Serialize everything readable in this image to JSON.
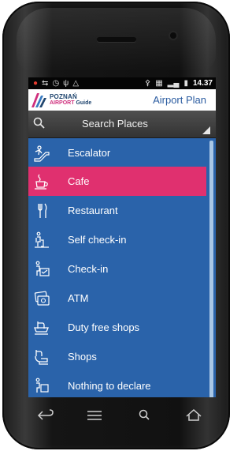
{
  "status_bar": {
    "time": "14.37",
    "icons": [
      "notification-icon",
      "link-icon",
      "alarm-icon",
      "usb-icon",
      "warning-icon",
      "wifi-icon",
      "vibrate-icon",
      "signal-icon",
      "battery-icon"
    ]
  },
  "header": {
    "logo_line1": "POZNAŃ",
    "logo_line2_a": "AIRPORT",
    "logo_line2_b": "Guide",
    "title": "Airport Plan"
  },
  "search": {
    "label": "Search Places"
  },
  "list": {
    "items": [
      {
        "label": "Escalator",
        "icon": "escalator-icon",
        "selected": false
      },
      {
        "label": "Cafe",
        "icon": "cafe-icon",
        "selected": true
      },
      {
        "label": "Restaurant",
        "icon": "restaurant-icon",
        "selected": false
      },
      {
        "label": "Self check-in",
        "icon": "self-check-in-icon",
        "selected": false
      },
      {
        "label": "Check-in",
        "icon": "check-in-icon",
        "selected": false
      },
      {
        "label": "ATM",
        "icon": "atm-icon",
        "selected": false
      },
      {
        "label": "Duty free shops",
        "icon": "duty-free-icon",
        "selected": false
      },
      {
        "label": "Shops",
        "icon": "shops-icon",
        "selected": false
      },
      {
        "label": "Nothing to declare",
        "icon": "nothing-to-declare-icon",
        "selected": false
      }
    ]
  },
  "colors": {
    "list_background": "#2a63aa",
    "selected": "#e0306f",
    "header_text": "#2c5da1"
  },
  "softkeys": [
    "back-icon",
    "menu-icon",
    "search-icon",
    "home-icon"
  ]
}
